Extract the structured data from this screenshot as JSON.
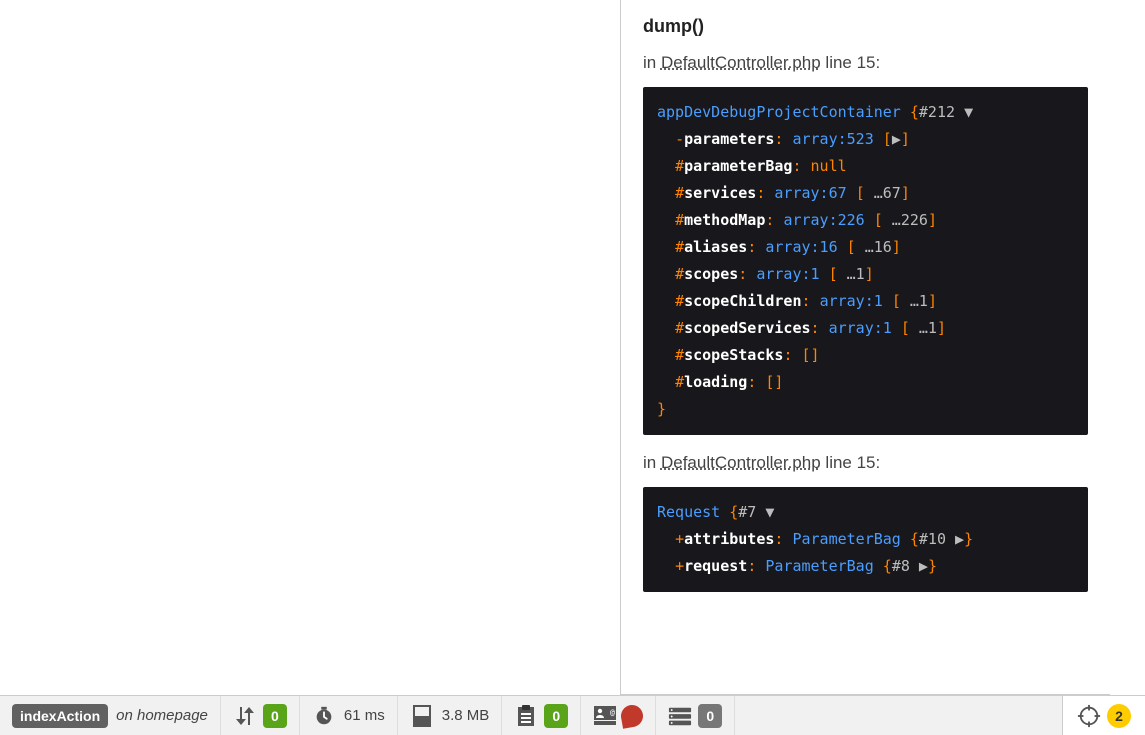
{
  "dump": {
    "title": "dump()",
    "location_prefix": "in ",
    "location_file": "DefaultController.php",
    "location_suffix": " line 15:",
    "entries": [
      {
        "class": "appDevDebugProjectContainer",
        "id": "#212",
        "props": [
          {
            "vis": "-",
            "name": "parameters",
            "type": "array:523",
            "toggle": "▶",
            "ellipsis": ""
          },
          {
            "vis": "#",
            "name": "parameterBag",
            "type": "null",
            "toggle": "",
            "ellipsis": ""
          },
          {
            "vis": "#",
            "name": "services",
            "type": "array:67",
            "toggle": "",
            "ellipsis": " …67"
          },
          {
            "vis": "#",
            "name": "methodMap",
            "type": "array:226",
            "toggle": "",
            "ellipsis": " …226"
          },
          {
            "vis": "#",
            "name": "aliases",
            "type": "array:16",
            "toggle": "",
            "ellipsis": " …16"
          },
          {
            "vis": "#",
            "name": "scopes",
            "type": "array:1",
            "toggle": "",
            "ellipsis": " …1"
          },
          {
            "vis": "#",
            "name": "scopeChildren",
            "type": "array:1",
            "toggle": "",
            "ellipsis": " …1"
          },
          {
            "vis": "#",
            "name": "scopedServices",
            "type": "array:1",
            "toggle": "",
            "ellipsis": " …1"
          },
          {
            "vis": "#",
            "name": "scopeStacks",
            "type": "",
            "toggle": "empty",
            "ellipsis": ""
          },
          {
            "vis": "#",
            "name": "loading",
            "type": "",
            "toggle": "empty",
            "ellipsis": ""
          }
        ]
      },
      {
        "class": "Request",
        "id": "#7",
        "props": [
          {
            "vis": "+",
            "name": "attributes",
            "type": "ParameterBag",
            "id": "#10",
            "toggle": "▶"
          },
          {
            "vis": "+",
            "name": "request",
            "type": "ParameterBag",
            "id": "#8",
            "toggle": "▶"
          }
        ]
      }
    ]
  },
  "toolbar": {
    "action": "indexAction",
    "route_prefix": "on ",
    "route": "homepage",
    "requests_count": "0",
    "time": "61 ms",
    "memory": "3.8 MB",
    "forms_count": "0",
    "db_count": "0",
    "dump_count": "2"
  }
}
